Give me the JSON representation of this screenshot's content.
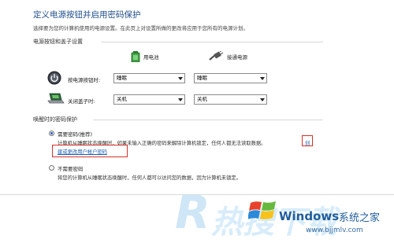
{
  "header": {
    "title": "定义电源按钮并启用密码保护",
    "description": "选择要为您的计算机使用的电源设置。在此页上对设置所做的更改将应用于您所有的电源计划。"
  },
  "power_buttons": {
    "section_title": "电源按钮和盖子设置",
    "battery_label": "用电池",
    "plugged_label": "接通电源",
    "rows": [
      {
        "label": "按电源按钮时:",
        "battery": "睡眠",
        "plugged": "睡眠"
      },
      {
        "label": "关闭盖子时:",
        "battery": "关机",
        "plugged": "关机"
      }
    ]
  },
  "password": {
    "section_title": "唤醒时的密码保护",
    "options": [
      {
        "label": "需要密码(推荐)",
        "checked": true,
        "desc": "计算机从睡眠状态唤醒时，如果未输入正确的密码来解除计算机锁定，任何人都无法读取数据。",
        "desc_tail": "创",
        "link": "建或更改用户帐户密码"
      },
      {
        "label": "不需要密码",
        "checked": false,
        "desc": "将您的计算机从睡眠状态唤醒时，任何人都可以访问您的数据，因为计算机未锁定。"
      }
    ]
  },
  "watermark": {
    "brand": "Windows",
    "cn": "系统之家",
    "url": "www.bjjmlv.com",
    "big_letter": "R",
    "big_cn": "热搜下载"
  },
  "colors": {
    "title": "#1f4e8c",
    "link": "#1a5fb4",
    "highlight_box": "#d8302a"
  }
}
